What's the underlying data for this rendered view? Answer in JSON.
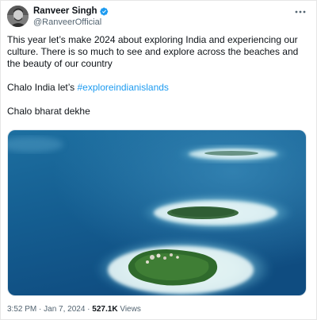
{
  "author": {
    "display_name": "Ranveer Singh",
    "handle": "@RanveerOfficial",
    "verified": true
  },
  "tweet": {
    "line1": "This year let’s make 2024 about exploring India and experiencing our culture. There is so much to see and explore across the beaches and the beauty of our country",
    "line2_prefix": "Chalo India let’s ",
    "hashtag": "#exploreindianislands",
    "line3": "Chalo bharat dekhe"
  },
  "meta": {
    "time": "3:52 PM",
    "separator1": " · ",
    "date": "Jan 7, 2024",
    "separator2": " · ",
    "views_count": "527.1K",
    "views_label": " Views"
  },
  "colors": {
    "link": "#1d9bf0",
    "verified": "#1d9bf0",
    "secondary_text": "#536471"
  },
  "icons": [
    "verified-badge-icon",
    "more-options-icon"
  ]
}
